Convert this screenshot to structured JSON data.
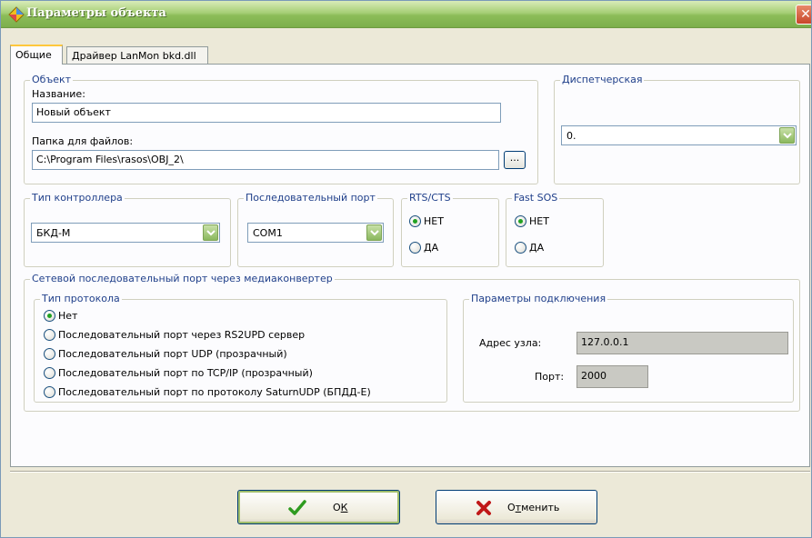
{
  "window": {
    "title": "Параметры объекта",
    "close_glyph": "✕"
  },
  "tabs": [
    {
      "label": "Общие",
      "active": true
    },
    {
      "label": "Драйвер LanMon bkd.dll",
      "active": false
    }
  ],
  "object_group": {
    "legend": "Объект",
    "name_label": "Название:",
    "name_value": "Новый объект",
    "folder_label": "Папка для файлов:",
    "folder_value": "C:\\Program Files\\rasos\\OBJ_2\\",
    "browse_label": "..."
  },
  "dispatcher_group": {
    "legend": "Диспетчерская",
    "value": "0."
  },
  "controller_group": {
    "legend": "Тип контроллера",
    "value": "БКД-М"
  },
  "serial_port_group": {
    "legend": "Последовательный порт",
    "value": "COM1"
  },
  "rts_cts_group": {
    "legend": "RTS/CTS",
    "options": [
      {
        "label": "НЕТ",
        "checked": true
      },
      {
        "label": "ДА",
        "checked": false
      }
    ]
  },
  "fast_sos_group": {
    "legend": "Fast SOS",
    "options": [
      {
        "label": "НЕТ",
        "checked": true
      },
      {
        "label": "ДА",
        "checked": false
      }
    ]
  },
  "network_group": {
    "legend": "Сетевой последовательный порт через медиаконвертер",
    "protocol_group": {
      "legend": "Тип протокола",
      "options": [
        {
          "label": "Нет",
          "checked": true
        },
        {
          "label": "Последовательный порт через RS2UPD сервер",
          "checked": false
        },
        {
          "label": "Последовательный порт UDP (прозрачный)",
          "checked": false
        },
        {
          "label": "Последовательный порт по TCP/IP (прозрачный)",
          "checked": false
        },
        {
          "label": "Последовательный порт по протоколу SaturnUDP (БПДД-Е)",
          "checked": false
        }
      ]
    },
    "connection_group": {
      "legend": "Параметры подключения",
      "address_label": "Адрес узла:",
      "address_value": "127.0.0.1",
      "port_label": "Порт:",
      "port_value": "2000"
    }
  },
  "buttons": {
    "ok_label_prefix": "О",
    "ok_label_underlined": "К",
    "cancel_label_prefix": "О",
    "cancel_label_underlined": "т",
    "cancel_label_rest": "менить"
  },
  "colors": {
    "title_gradient_top": "#d9ebb9",
    "title_gradient_bottom": "#7cae4b",
    "legend_text": "#1f3f8a",
    "ok_check": "#2e9b1f",
    "cancel_x": "#c01818"
  }
}
